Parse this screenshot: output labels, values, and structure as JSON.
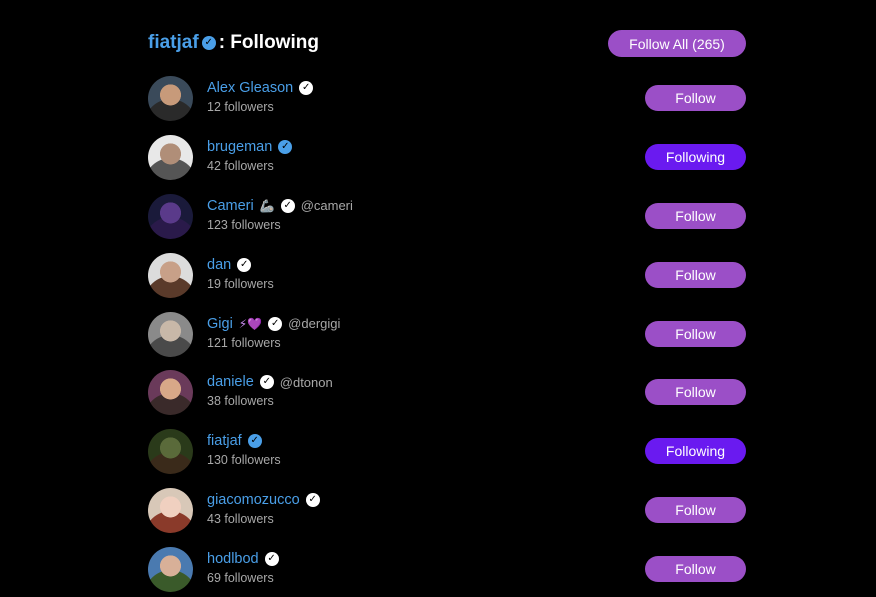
{
  "header": {
    "name": "fiatjaf",
    "suffix": ": Following",
    "follow_all_label": "Follow All (265)"
  },
  "users": [
    {
      "name": "Alex Gleason",
      "emoji": "",
      "handle": "",
      "followers": "12 followers",
      "button": "Follow",
      "badge": "white",
      "avatar_colors": [
        "#3a4a5a",
        "#c79a7a",
        "#2a2a2a"
      ]
    },
    {
      "name": "brugeman",
      "emoji": "",
      "handle": "",
      "followers": "42 followers",
      "button": "Following",
      "badge": "blue",
      "avatar_colors": [
        "#e8e8e8",
        "#b08e78",
        "#555555"
      ]
    },
    {
      "name": "Cameri",
      "emoji": "🦾",
      "handle": "@cameri",
      "followers": "123 followers",
      "button": "Follow",
      "badge": "white",
      "avatar_colors": [
        "#1a1a3a",
        "#5a3a8a",
        "#2a1a4a"
      ]
    },
    {
      "name": "dan",
      "emoji": "",
      "handle": "",
      "followers": "19 followers",
      "button": "Follow",
      "badge": "white",
      "avatar_colors": [
        "#dcdcdc",
        "#c8a088",
        "#5a3a2a"
      ]
    },
    {
      "name": "Gigi",
      "emoji": "⚡💜",
      "handle": "@dergigi",
      "followers": "121 followers",
      "button": "Follow",
      "badge": "white",
      "avatar_colors": [
        "#8a8a8a",
        "#c8b8a8",
        "#4a4a4a"
      ]
    },
    {
      "name": "daniele",
      "emoji": "",
      "handle": "@dtonon",
      "followers": "38 followers",
      "button": "Follow",
      "badge": "white",
      "avatar_colors": [
        "#6a3a5a",
        "#d8a888",
        "#3a2a2a"
      ]
    },
    {
      "name": "fiatjaf",
      "emoji": "",
      "handle": "",
      "followers": "130 followers",
      "button": "Following",
      "badge": "blue",
      "avatar_colors": [
        "#2a3a1a",
        "#5a6a3a",
        "#3a2a1a"
      ]
    },
    {
      "name": "giacomozucco",
      "emoji": "",
      "handle": "",
      "followers": "43 followers",
      "button": "Follow",
      "badge": "white",
      "avatar_colors": [
        "#d8c8b8",
        "#f0d0c0",
        "#8a3a2a"
      ]
    },
    {
      "name": "hodlbod",
      "emoji": "",
      "handle": "",
      "followers": "69 followers",
      "button": "Follow",
      "badge": "white",
      "avatar_colors": [
        "#4a7ab0",
        "#d8b098",
        "#3a5a2a"
      ]
    }
  ],
  "colors": {
    "background": "#000000",
    "link_blue": "#4a9fe8",
    "follow_button": "#9b4fc7",
    "following_button": "#6a1af0",
    "muted_text": "#a8a8a8"
  },
  "icons": {
    "verified": "checkmark-badge-icon"
  }
}
